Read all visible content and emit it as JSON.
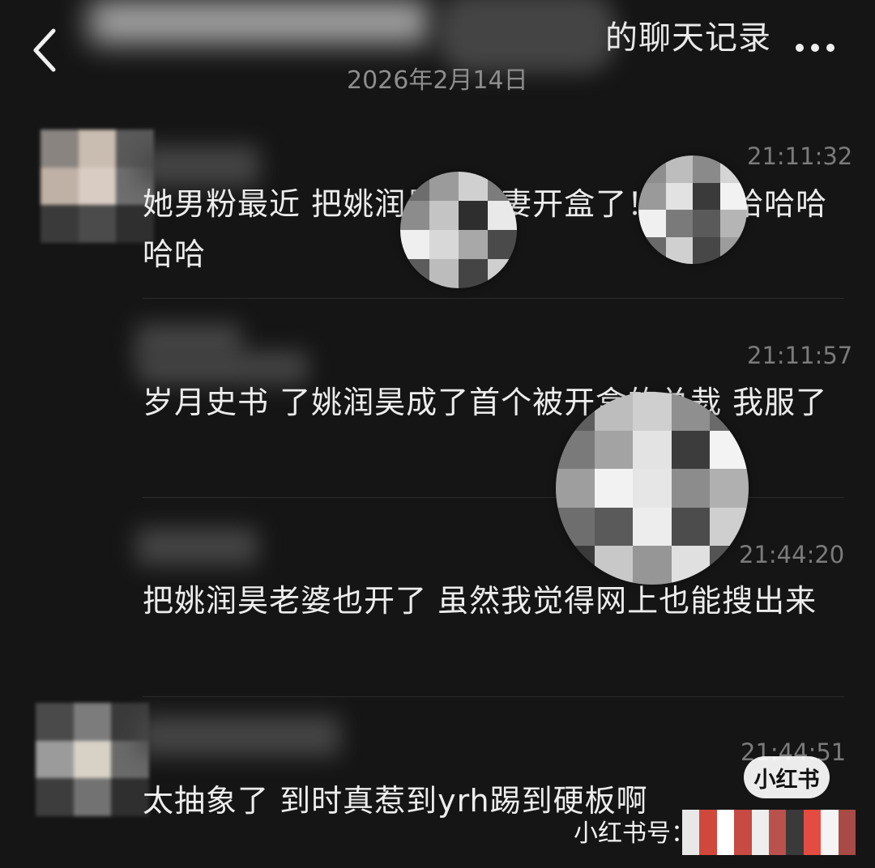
{
  "header": {
    "title": "的聊天记录",
    "date": "2026年2月14日",
    "back_icon": "chevron-left-icon",
    "more_icon": "more-dots-icon"
  },
  "messages": [
    {
      "time": "21:11:32",
      "text": "她男粉最近 把姚润昊两夫妻开盒了！ 哈哈哈哈哈哈哈"
    },
    {
      "time": "21:11:57",
      "text": "岁月史书 了姚润昊成了首个被开盒的总裁 我服了"
    },
    {
      "time": "21:44:20",
      "text": "把姚润昊老婆也开了 虽然我觉得网上也能搜出来"
    },
    {
      "time": "21:44:51",
      "text": "太抽象了 到时真惹到yrh踢到硬板啊"
    }
  ],
  "watermark": {
    "badge": "小红书",
    "id_label": "小红书号：6"
  },
  "colors": {
    "background": "#151515",
    "text": "#ededed",
    "time": "#7b7b7b",
    "date": "#8d8d8d"
  }
}
